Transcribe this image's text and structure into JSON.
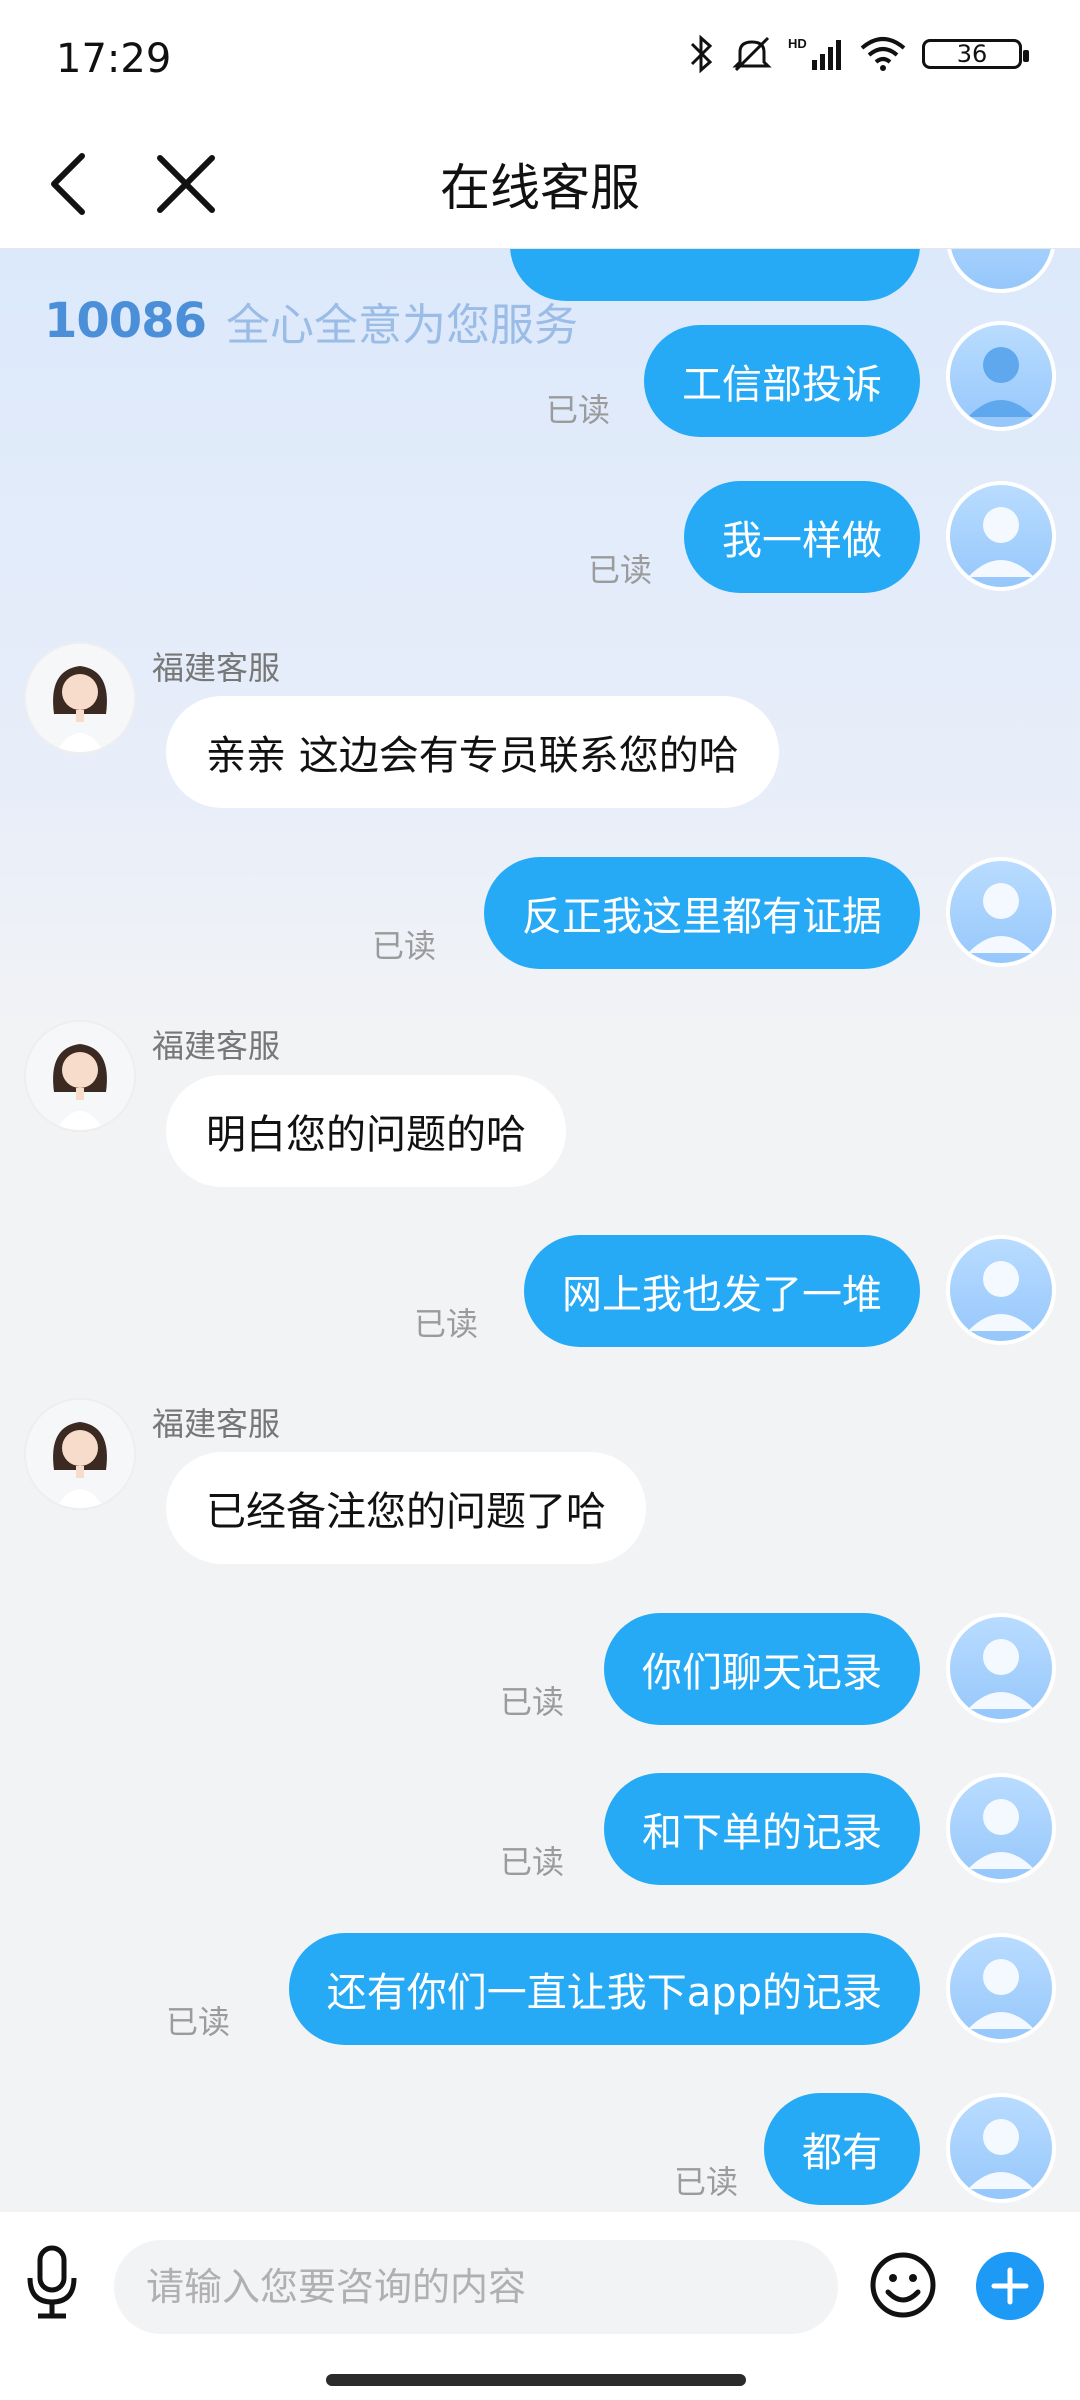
{
  "status": {
    "time": "17:29",
    "battery": "36"
  },
  "nav": {
    "title": "在线客服"
  },
  "banner": {
    "logo": "10086",
    "slogan": "全心全意为您服务"
  },
  "messages": {
    "m1": {
      "text": "工信部投诉",
      "read": "已读"
    },
    "m2": {
      "text": "我一样做",
      "read": "已读"
    },
    "m3": {
      "sender": "福建客服",
      "text": "亲亲  这边会有专员联系您的哈"
    },
    "m4": {
      "text": "反正我这里都有证据",
      "read": "已读"
    },
    "m5": {
      "sender": "福建客服",
      "text": "明白您的问题的哈"
    },
    "m6": {
      "text": "网上我也发了一堆",
      "read": "已读"
    },
    "m7": {
      "sender": "福建客服",
      "text": "已经备注您的问题了哈"
    },
    "m8": {
      "text": "你们聊天记录",
      "read": "已读"
    },
    "m9": {
      "text": "和下单的记录",
      "read": "已读"
    },
    "m10": {
      "text": "还有你们一直让我下app的记录",
      "read": "已读"
    },
    "m11": {
      "text": "都有",
      "read": "已读"
    }
  },
  "input": {
    "placeholder": "请输入您要咨询的内容"
  },
  "colors": {
    "bubble_user": "#27aaf5",
    "bubble_agent": "#ffffff",
    "plus_button": "#1d9af5"
  },
  "icons": [
    "back-arrow-icon",
    "close-icon",
    "bluetooth-icon",
    "mute-icon",
    "signal-icon",
    "wifi-icon",
    "battery-icon",
    "microphone-icon",
    "emoji-icon",
    "plus-icon",
    "user-avatar-icon"
  ]
}
